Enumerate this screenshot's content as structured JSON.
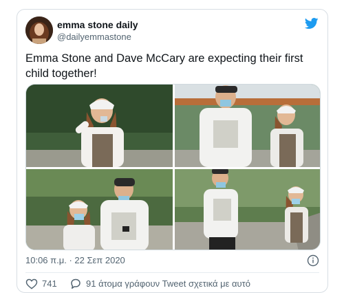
{
  "tweet": {
    "display_name": "emma stone daily",
    "handle": "@dailyemmastone",
    "text": "Emma Stone and Dave McCary are expecting their first child together!",
    "timestamp": "10:06 π.μ. · 22 Σεπ 2020",
    "like_count": "741",
    "reply_text": "91 άτομα γράφουν Tweet σχετικά με αυτό"
  },
  "icons": {
    "brand": "twitter-bird-icon",
    "info": "info-icon",
    "like": "heart-icon",
    "reply": "reply-bubble-icon"
  },
  "colors": {
    "brand_blue": "#1d9bf0",
    "secondary_text": "#536471",
    "border": "#d7dde3"
  }
}
